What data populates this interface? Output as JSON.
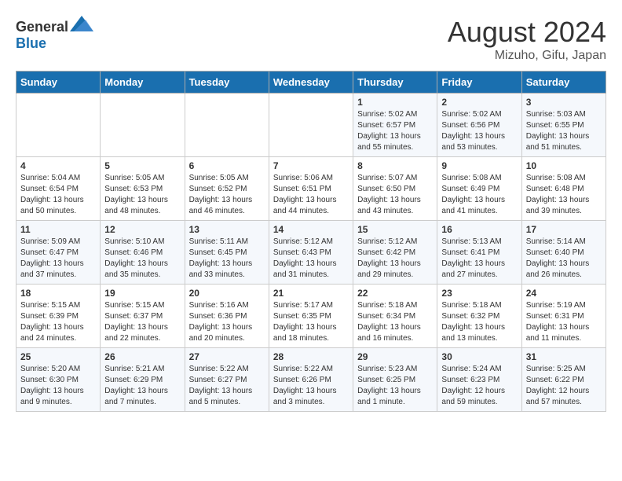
{
  "header": {
    "logo_general": "General",
    "logo_blue": "Blue",
    "month_year": "August 2024",
    "location": "Mizuho, Gifu, Japan"
  },
  "days_of_week": [
    "Sunday",
    "Monday",
    "Tuesday",
    "Wednesday",
    "Thursday",
    "Friday",
    "Saturday"
  ],
  "weeks": [
    [
      {
        "day": "",
        "info": ""
      },
      {
        "day": "",
        "info": ""
      },
      {
        "day": "",
        "info": ""
      },
      {
        "day": "",
        "info": ""
      },
      {
        "day": "1",
        "info": "Sunrise: 5:02 AM\nSunset: 6:57 PM\nDaylight: 13 hours\nand 55 minutes."
      },
      {
        "day": "2",
        "info": "Sunrise: 5:02 AM\nSunset: 6:56 PM\nDaylight: 13 hours\nand 53 minutes."
      },
      {
        "day": "3",
        "info": "Sunrise: 5:03 AM\nSunset: 6:55 PM\nDaylight: 13 hours\nand 51 minutes."
      }
    ],
    [
      {
        "day": "4",
        "info": "Sunrise: 5:04 AM\nSunset: 6:54 PM\nDaylight: 13 hours\nand 50 minutes."
      },
      {
        "day": "5",
        "info": "Sunrise: 5:05 AM\nSunset: 6:53 PM\nDaylight: 13 hours\nand 48 minutes."
      },
      {
        "day": "6",
        "info": "Sunrise: 5:05 AM\nSunset: 6:52 PM\nDaylight: 13 hours\nand 46 minutes."
      },
      {
        "day": "7",
        "info": "Sunrise: 5:06 AM\nSunset: 6:51 PM\nDaylight: 13 hours\nand 44 minutes."
      },
      {
        "day": "8",
        "info": "Sunrise: 5:07 AM\nSunset: 6:50 PM\nDaylight: 13 hours\nand 43 minutes."
      },
      {
        "day": "9",
        "info": "Sunrise: 5:08 AM\nSunset: 6:49 PM\nDaylight: 13 hours\nand 41 minutes."
      },
      {
        "day": "10",
        "info": "Sunrise: 5:08 AM\nSunset: 6:48 PM\nDaylight: 13 hours\nand 39 minutes."
      }
    ],
    [
      {
        "day": "11",
        "info": "Sunrise: 5:09 AM\nSunset: 6:47 PM\nDaylight: 13 hours\nand 37 minutes."
      },
      {
        "day": "12",
        "info": "Sunrise: 5:10 AM\nSunset: 6:46 PM\nDaylight: 13 hours\nand 35 minutes."
      },
      {
        "day": "13",
        "info": "Sunrise: 5:11 AM\nSunset: 6:45 PM\nDaylight: 13 hours\nand 33 minutes."
      },
      {
        "day": "14",
        "info": "Sunrise: 5:12 AM\nSunset: 6:43 PM\nDaylight: 13 hours\nand 31 minutes."
      },
      {
        "day": "15",
        "info": "Sunrise: 5:12 AM\nSunset: 6:42 PM\nDaylight: 13 hours\nand 29 minutes."
      },
      {
        "day": "16",
        "info": "Sunrise: 5:13 AM\nSunset: 6:41 PM\nDaylight: 13 hours\nand 27 minutes."
      },
      {
        "day": "17",
        "info": "Sunrise: 5:14 AM\nSunset: 6:40 PM\nDaylight: 13 hours\nand 26 minutes."
      }
    ],
    [
      {
        "day": "18",
        "info": "Sunrise: 5:15 AM\nSunset: 6:39 PM\nDaylight: 13 hours\nand 24 minutes."
      },
      {
        "day": "19",
        "info": "Sunrise: 5:15 AM\nSunset: 6:37 PM\nDaylight: 13 hours\nand 22 minutes."
      },
      {
        "day": "20",
        "info": "Sunrise: 5:16 AM\nSunset: 6:36 PM\nDaylight: 13 hours\nand 20 minutes."
      },
      {
        "day": "21",
        "info": "Sunrise: 5:17 AM\nSunset: 6:35 PM\nDaylight: 13 hours\nand 18 minutes."
      },
      {
        "day": "22",
        "info": "Sunrise: 5:18 AM\nSunset: 6:34 PM\nDaylight: 13 hours\nand 16 minutes."
      },
      {
        "day": "23",
        "info": "Sunrise: 5:18 AM\nSunset: 6:32 PM\nDaylight: 13 hours\nand 13 minutes."
      },
      {
        "day": "24",
        "info": "Sunrise: 5:19 AM\nSunset: 6:31 PM\nDaylight: 13 hours\nand 11 minutes."
      }
    ],
    [
      {
        "day": "25",
        "info": "Sunrise: 5:20 AM\nSunset: 6:30 PM\nDaylight: 13 hours\nand 9 minutes."
      },
      {
        "day": "26",
        "info": "Sunrise: 5:21 AM\nSunset: 6:29 PM\nDaylight: 13 hours\nand 7 minutes."
      },
      {
        "day": "27",
        "info": "Sunrise: 5:22 AM\nSunset: 6:27 PM\nDaylight: 13 hours\nand 5 minutes."
      },
      {
        "day": "28",
        "info": "Sunrise: 5:22 AM\nSunset: 6:26 PM\nDaylight: 13 hours\nand 3 minutes."
      },
      {
        "day": "29",
        "info": "Sunrise: 5:23 AM\nSunset: 6:25 PM\nDaylight: 13 hours\nand 1 minute."
      },
      {
        "day": "30",
        "info": "Sunrise: 5:24 AM\nSunset: 6:23 PM\nDaylight: 12 hours\nand 59 minutes."
      },
      {
        "day": "31",
        "info": "Sunrise: 5:25 AM\nSunset: 6:22 PM\nDaylight: 12 hours\nand 57 minutes."
      }
    ]
  ]
}
